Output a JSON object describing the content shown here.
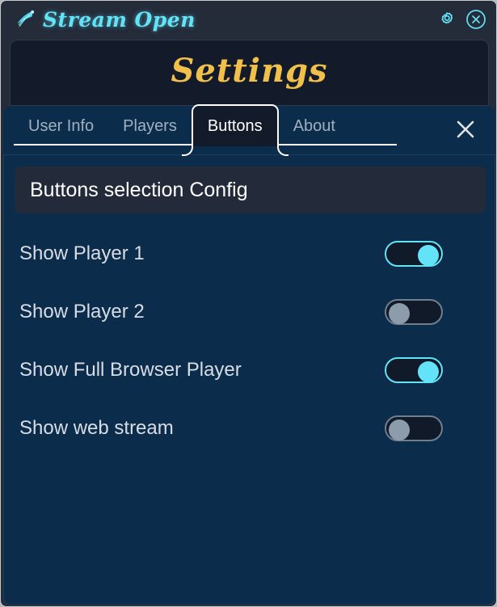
{
  "window": {
    "title": "Stream Open",
    "logo_icon": "comet-star-icon",
    "actions": [
      {
        "name": "settings-gear-button",
        "icon": "gear-icon"
      },
      {
        "name": "window-close-button",
        "icon": "close-circle-icon"
      }
    ]
  },
  "settings": {
    "heading": "Settings"
  },
  "tabs": {
    "items": [
      {
        "label": "User Info",
        "active": false
      },
      {
        "label": "Players",
        "active": false
      },
      {
        "label": "Buttons",
        "active": true
      },
      {
        "label": "About",
        "active": false
      }
    ],
    "close_icon": "close-icon"
  },
  "main": {
    "section_title": "Buttons selection Config",
    "rows": [
      {
        "label": "Show Player 1",
        "state": "on"
      },
      {
        "label": "Show Player 2",
        "state": "off"
      },
      {
        "label": "Show Full Browser Player",
        "state": "on"
      },
      {
        "label": "Show web stream",
        "state": "off"
      }
    ]
  },
  "colors": {
    "accent_cyan": "#62e3f7",
    "gold": "#f0c04a",
    "titlebar_bg": "#242b39",
    "panel_dark": "#131a2a",
    "body_bg": "#0c2c4c",
    "config_bar_bg": "#232b3a",
    "toggle_off_gray": "#8d9cab"
  }
}
